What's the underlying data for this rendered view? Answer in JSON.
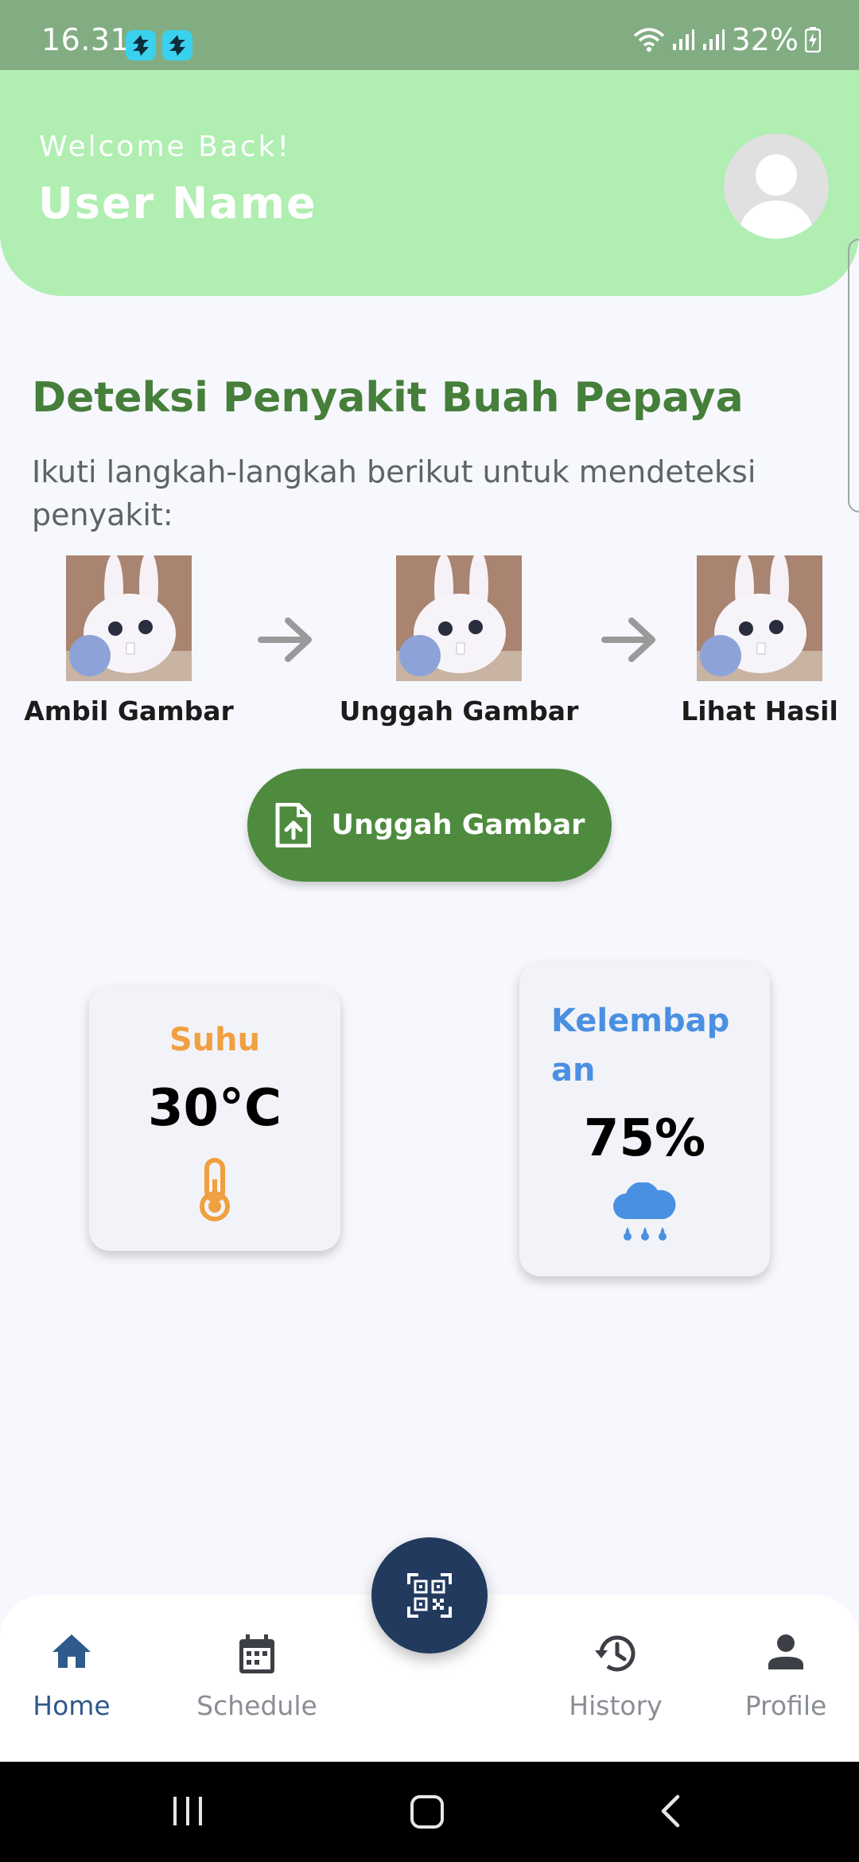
{
  "status_bar": {
    "time": "16.31",
    "battery": "32%",
    "icons": [
      "app-notification-icon",
      "app-notification-icon",
      "wifi-icon",
      "signal-icon",
      "signal-icon",
      "battery-charging-icon"
    ]
  },
  "header": {
    "welcome": "Welcome Back!",
    "username": "User Name",
    "avatar_icon": "person-icon"
  },
  "main": {
    "title": "Deteksi Penyakit Buah Pepaya",
    "subtitle": "Ikuti langkah-langkah berikut untuk mendeteksi penyakit:",
    "steps": [
      {
        "label": "Ambil Gambar"
      },
      {
        "label": "Unggah Gambar"
      },
      {
        "label": "Lihat Hasil"
      }
    ],
    "upload_button": "Unggah Gambar"
  },
  "weather": {
    "temperature": {
      "title": "Suhu",
      "value": "30°C",
      "icon": "thermometer-icon"
    },
    "humidity": {
      "title": "Kelembap an",
      "value": "75%",
      "icon": "rain-cloud-icon"
    }
  },
  "nav": {
    "items": [
      {
        "label": "Home",
        "icon": "home-icon",
        "active": true
      },
      {
        "label": "Schedule",
        "icon": "calendar-icon",
        "active": false
      },
      {
        "label": "History",
        "icon": "history-icon",
        "active": false
      },
      {
        "label": "Profile",
        "icon": "person-icon",
        "active": false
      }
    ],
    "fab_icon": "qr-code-icon"
  },
  "colors": {
    "header_bg": "#b0eeb2",
    "status_bar_bg": "#82ad83",
    "title_green": "#457f3a",
    "button_green": "#4e8b3e",
    "temperature_orange": "#f0a040",
    "humidity_blue": "#4a90e2",
    "nav_active": "#2f5a8c",
    "nav_inactive": "#8a8e96",
    "fab_bg": "#223a5e"
  }
}
